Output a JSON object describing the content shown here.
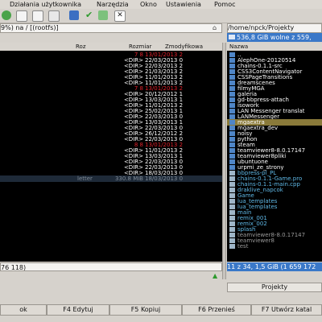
{
  "menubar": {
    "items": [
      "Działania użytkownika",
      "Narzędzia",
      "Okno",
      "Ustawienia",
      "Pomoc"
    ]
  },
  "left_panel": {
    "path": "9%) na / [(rootfs)]",
    "columns": [
      "Roz",
      "Rozmiar",
      "Zmodyfikowa"
    ],
    "rows": [
      {
        "size": "7 8",
        "date": "13/01/2013 2",
        "color": "#e0202a"
      },
      {
        "size": "<DIR>",
        "date": "22/03/2013 0",
        "color": "#ffffff"
      },
      {
        "size": "<DIR>",
        "date": "22/03/2013 2",
        "color": "#ffffff"
      },
      {
        "size": "<DIR>",
        "date": "21/03/2013 2",
        "color": "#ffffff"
      },
      {
        "size": "<DIR>",
        "date": "11/01/2013 2",
        "color": "#ffffff"
      },
      {
        "size": "<DIR>",
        "date": "11/01/2013 2",
        "color": "#ffffff"
      },
      {
        "size": "7 8",
        "date": "13/01/2013 2",
        "color": "#e0202a"
      },
      {
        "size": "<DIR>",
        "date": "20/12/2012 1",
        "color": "#ffffff"
      },
      {
        "size": "<DIR>",
        "date": "13/03/2013 1",
        "color": "#ffffff"
      },
      {
        "size": "<DIR>",
        "date": "11/01/2013 2",
        "color": "#ffffff"
      },
      {
        "size": "<DIR>",
        "date": "25/02/2013 1",
        "color": "#ffffff"
      },
      {
        "size": "<DIR>",
        "date": "22/03/2013 0",
        "color": "#ffffff"
      },
      {
        "size": "<DIR>",
        "date": "13/03/2013 1",
        "color": "#ffffff"
      },
      {
        "size": "<DIR>",
        "date": "22/03/2013 0",
        "color": "#ffffff"
      },
      {
        "size": "<DIR>",
        "date": "26/12/2012 2",
        "color": "#ffffff"
      },
      {
        "size": "<DIR>",
        "date": "22/03/2013 0",
        "color": "#ffffff"
      },
      {
        "size": "8 8",
        "date": "13/01/2013 2",
        "color": "#e0202a"
      },
      {
        "size": "<DIR>",
        "date": "11/01/2013 2",
        "color": "#ffffff"
      },
      {
        "size": "<DIR>",
        "date": "13/03/2013 1",
        "color": "#ffffff"
      },
      {
        "size": "<DIR>",
        "date": "22/03/2013 0",
        "color": "#ffffff"
      },
      {
        "size": "<DIR>",
        "date": "22/03/2013 0",
        "color": "#ffffff"
      },
      {
        "size": "<DIR>",
        "date": "18/03/2013 0",
        "color": "#ffffff"
      }
    ],
    "file_row": {
      "name": "letter",
      "size": "330.8 MiB",
      "date": "18/03/2013 0"
    }
  },
  "right_panel": {
    "path": "/home/npck/Projekty",
    "free": "536,8 GiB wolne z 559,",
    "column": "Nazwa",
    "items": [
      {
        "name": "..",
        "color": "#ffffff"
      },
      {
        "name": "AlephOne-20120514",
        "color": "#ffffff"
      },
      {
        "name": "chains-0.1.1-src",
        "color": "#ffffff"
      },
      {
        "name": "CSS3ContentNavigator",
        "color": "#ffffff"
      },
      {
        "name": "CSSPageTransitions",
        "color": "#ffffff"
      },
      {
        "name": "dreamscenes",
        "color": "#ffffff"
      },
      {
        "name": "filmyMGA",
        "color": "#ffffff"
      },
      {
        "name": "galeria",
        "color": "#ffffff"
      },
      {
        "name": "gd-bbpress-attach",
        "color": "#ffffff"
      },
      {
        "name": "isowork",
        "color": "#ffffff"
      },
      {
        "name": "LAN Messenger translat",
        "color": "#ffffff"
      },
      {
        "name": "LANMessenger",
        "color": "#ffffff"
      },
      {
        "name": "mgaextra",
        "color": "#ffffff"
      },
      {
        "name": "mgaextra_dev",
        "color": "#ffffff"
      },
      {
        "name": "noisy",
        "color": "#ffffff"
      },
      {
        "name": "python",
        "color": "#ffffff"
      },
      {
        "name": "steam",
        "color": "#ffffff"
      },
      {
        "name": "teamviewer8-8.0.17147",
        "color": "#ffffff"
      },
      {
        "name": "teamviewer8pliki",
        "color": "#ffffff"
      },
      {
        "name": "ubuntuone",
        "color": "#ffffff"
      },
      {
        "name": "urpmi_ze_strony",
        "color": "#ffffff"
      },
      {
        "name": "bbpress-pl_PL",
        "color": "#5fb8e6"
      },
      {
        "name": "chains-0.1.1-Game.pro",
        "color": "#5fb8e6"
      },
      {
        "name": "chains-0.1.1-main.cpp",
        "color": "#5fb8e6"
      },
      {
        "name": "draklive_napcok",
        "color": "#5fb8e6"
      },
      {
        "name": "Game",
        "color": "#5fb8e6"
      },
      {
        "name": "lua_templates",
        "color": "#5fb8e6"
      },
      {
        "name": "lua_templates",
        "color": "#5fb8e6"
      },
      {
        "name": "main",
        "color": "#5fb8e6"
      },
      {
        "name": "remix_001",
        "color": "#5fb8e6"
      },
      {
        "name": "remix_002",
        "color": "#5fb8e6"
      },
      {
        "name": "splash",
        "color": "#5fb8e6"
      },
      {
        "name": "teamviewer8-8.0.17147",
        "color": "#9a9a9a"
      },
      {
        "name": "teamviewer8",
        "color": "#9a9a9a"
      },
      {
        "name": "test",
        "color": "#9a9a9a"
      }
    ],
    "status": "11 z 34, 1,5 GiB (1 659 172",
    "tab": "Projekty"
  },
  "left_status": "76 118)",
  "fkeys": [
    {
      "label": "ok"
    },
    {
      "label": "F4 Edytuj"
    },
    {
      "label": "F5 Kopiuj"
    },
    {
      "label": "F6 Przenieś"
    },
    {
      "label": "F7 Utwórz katal"
    }
  ]
}
